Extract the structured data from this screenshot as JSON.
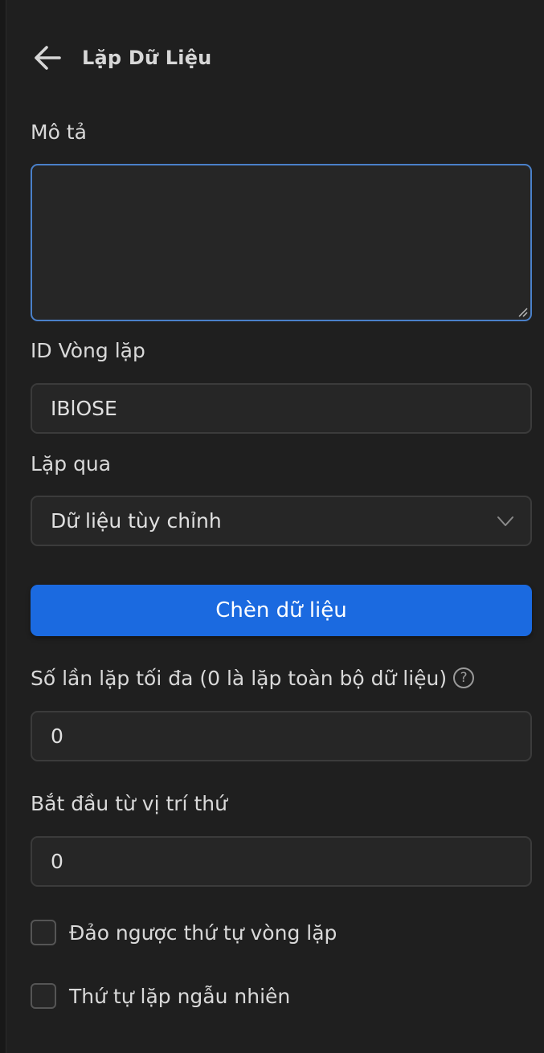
{
  "header": {
    "title": "Lặp Dữ Liệu"
  },
  "form": {
    "description_label": "Mô tả",
    "description_value": "",
    "loop_id_label": "ID Vòng lặp",
    "loop_id_value": "IBlOSE",
    "loop_through_label": "Lặp qua",
    "loop_through_value": "Dữ liệu tùy chỉnh",
    "insert_data_button": "Chèn dữ liệu",
    "max_loops_label": "Số lần lặp tối đa (0 là lặp toàn bộ dữ liệu)",
    "max_loops_value": "0",
    "start_index_label": "Bắt đầu từ vị trí thứ",
    "start_index_value": "0",
    "reverse_label": "Đảo ngược thứ tự vòng lặp",
    "reverse_checked": false,
    "random_label": "Thứ tự lặp ngẫu nhiên",
    "random_checked": false
  },
  "icons": {
    "back": "arrow-left-icon",
    "help": "question-circle-icon",
    "chevron": "chevron-down-icon",
    "resize": "resize-handle-icon"
  },
  "colors": {
    "background": "#1f1f1f",
    "field_background": "#262626",
    "field_border": "#3b3b3b",
    "focus_border": "#4a80c9",
    "primary": "#1b6ae0",
    "text": "#d9d9d9"
  }
}
